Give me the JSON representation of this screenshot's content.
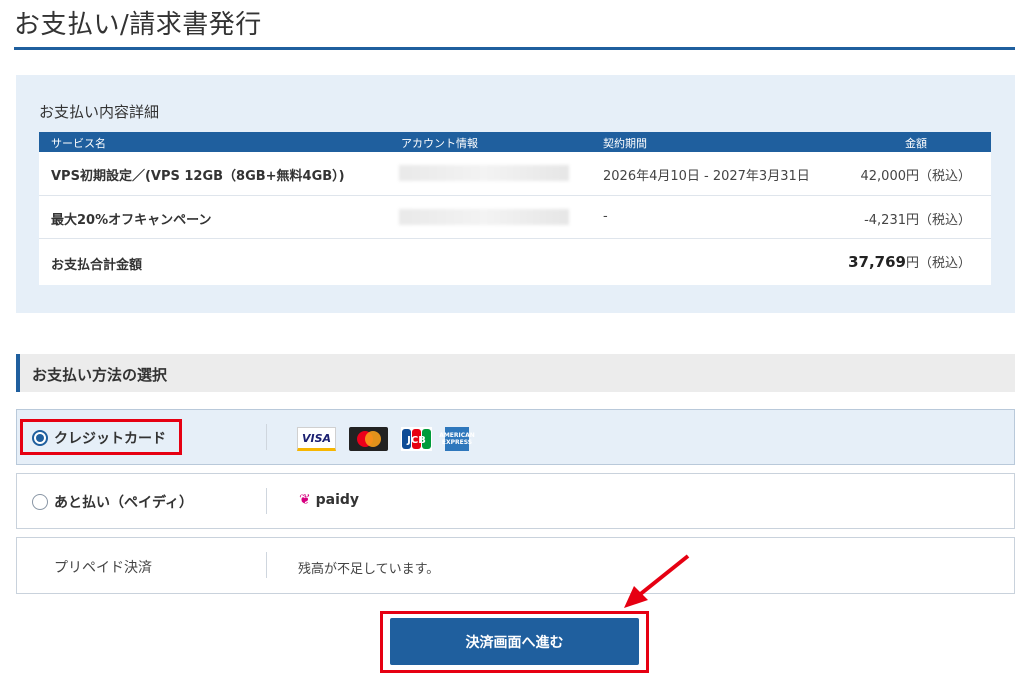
{
  "page": {
    "title": "お支払い/請求書発行"
  },
  "detail": {
    "heading": "お支払い内容詳細",
    "columns": [
      "サービス名",
      "アカウント情報",
      "契約期間",
      "金額"
    ],
    "rows": [
      {
        "name": "VPS初期設定／(VPS 12GB（8GB+無料4GB）)",
        "period": "2026年4月10日 - 2027年3月31日",
        "amount": "42,000円（税込）"
      },
      {
        "name": "最大20%オフキャンペーン",
        "period": "-",
        "amount": "-4,231円（税込）"
      }
    ],
    "total": {
      "label": "お支払合計金額",
      "amount": "37,769",
      "suffix": "円（税込）"
    }
  },
  "method": {
    "heading": "お支払い方法の選択",
    "options": [
      {
        "label": "クレジットカード",
        "selected": true,
        "logos": [
          "VISA",
          "Mastercard",
          "JCB",
          "AMEX"
        ]
      },
      {
        "label": "あと払い（ペイディ）",
        "selected": false,
        "brand": "paidy"
      },
      {
        "label": "プリペイド決済",
        "note": "残高が不足しています。"
      }
    ]
  },
  "actions": {
    "proceed": "決済画面へ進む"
  },
  "colors": {
    "accent": "#1f5f9e",
    "highlight": "#e60012",
    "panel": "#e6eff8"
  }
}
